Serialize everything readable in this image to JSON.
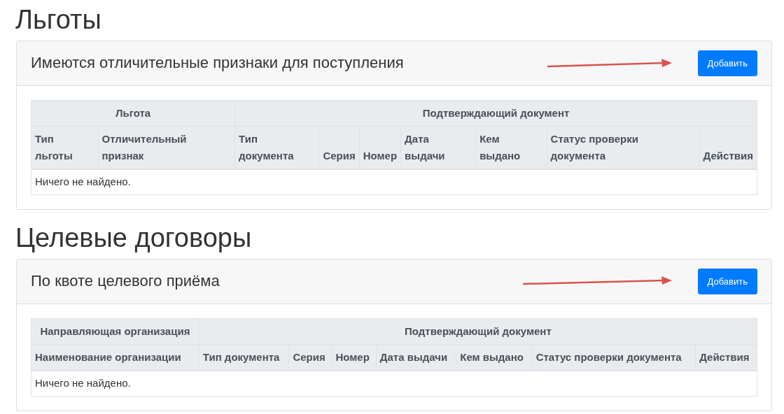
{
  "sections": [
    {
      "title": "Льготы",
      "card_title": "Имеются отличительные признаки для поступления",
      "button": "Добавить",
      "table": {
        "groups": [
          {
            "label": "Льгота",
            "columns": [
              "Тип льготы",
              "Отличительный признак"
            ]
          },
          {
            "label": "Подтверждающий документ",
            "columns": [
              "Тип документа",
              "Серия",
              "Номер",
              "Дата выдачи",
              "Кем выдано",
              "Статус проверки документа",
              "Действия"
            ]
          }
        ],
        "empty_text": "Ничего не найдено."
      }
    },
    {
      "title": "Целевые договоры",
      "card_title": "По квоте целевого приёма",
      "button": "Добавить",
      "table": {
        "groups": [
          {
            "label": "Направляющая организация",
            "columns": [
              "Наименование организации"
            ]
          },
          {
            "label": "Подтверждающий документ",
            "columns": [
              "Тип документа",
              "Серия",
              "Номер",
              "Дата выдачи",
              "Кем выдано",
              "Статус проверки документа",
              "Действия"
            ]
          }
        ],
        "empty_text": "Ничего не найдено."
      }
    }
  ]
}
